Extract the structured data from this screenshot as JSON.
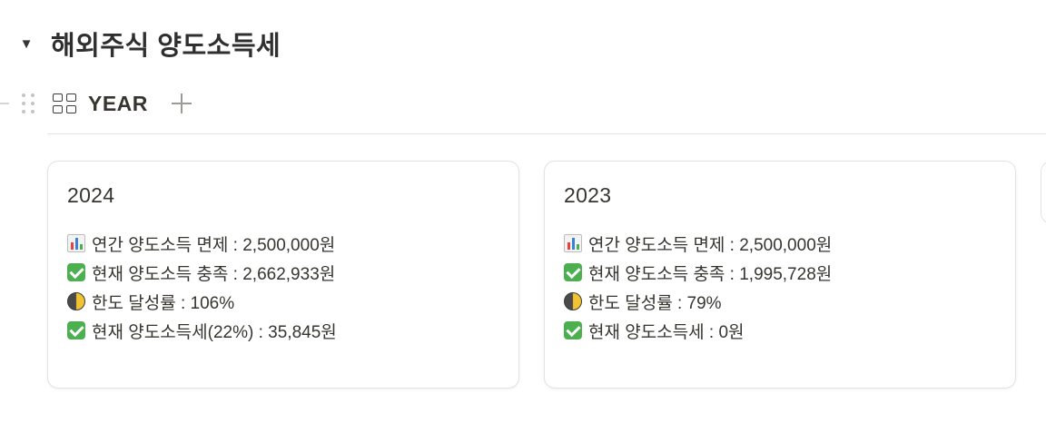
{
  "section": {
    "title": "해외주식 양도소득세",
    "toggle_icon": "▼"
  },
  "view_bar": {
    "tab_label": "YEAR",
    "tab_icon": "gallery-icon",
    "add_icon": "plus-icon"
  },
  "cards": [
    {
      "title": "2024",
      "lines": [
        {
          "icon": "bar-chart-emoji",
          "text": "연간 양도소득 면제 : 2,500,000원"
        },
        {
          "icon": "check-mark-emoji",
          "text": "현재 양도소득 충족 : 2,662,933원"
        },
        {
          "icon": "half-moon-emoji",
          "text": "한도 달성률 : 106%"
        },
        {
          "icon": "check-mark-emoji",
          "text": "현재 양도소득세(22%) : 35,845원"
        }
      ]
    },
    {
      "title": "2023",
      "lines": [
        {
          "icon": "bar-chart-emoji",
          "text": "연간 양도소득 면제 : 2,500,000원"
        },
        {
          "icon": "check-mark-emoji",
          "text": "현재 양도소득 충족 : 1,995,728원"
        },
        {
          "icon": "half-moon-emoji",
          "text": "한도 달성률 : 79%"
        },
        {
          "icon": "check-mark-emoji",
          "text": "현재 양도소득세 : 0원"
        }
      ]
    }
  ],
  "colors": {
    "text": "#37352f",
    "check_green": "#4caf50",
    "card_border": "#e3e3e1"
  }
}
